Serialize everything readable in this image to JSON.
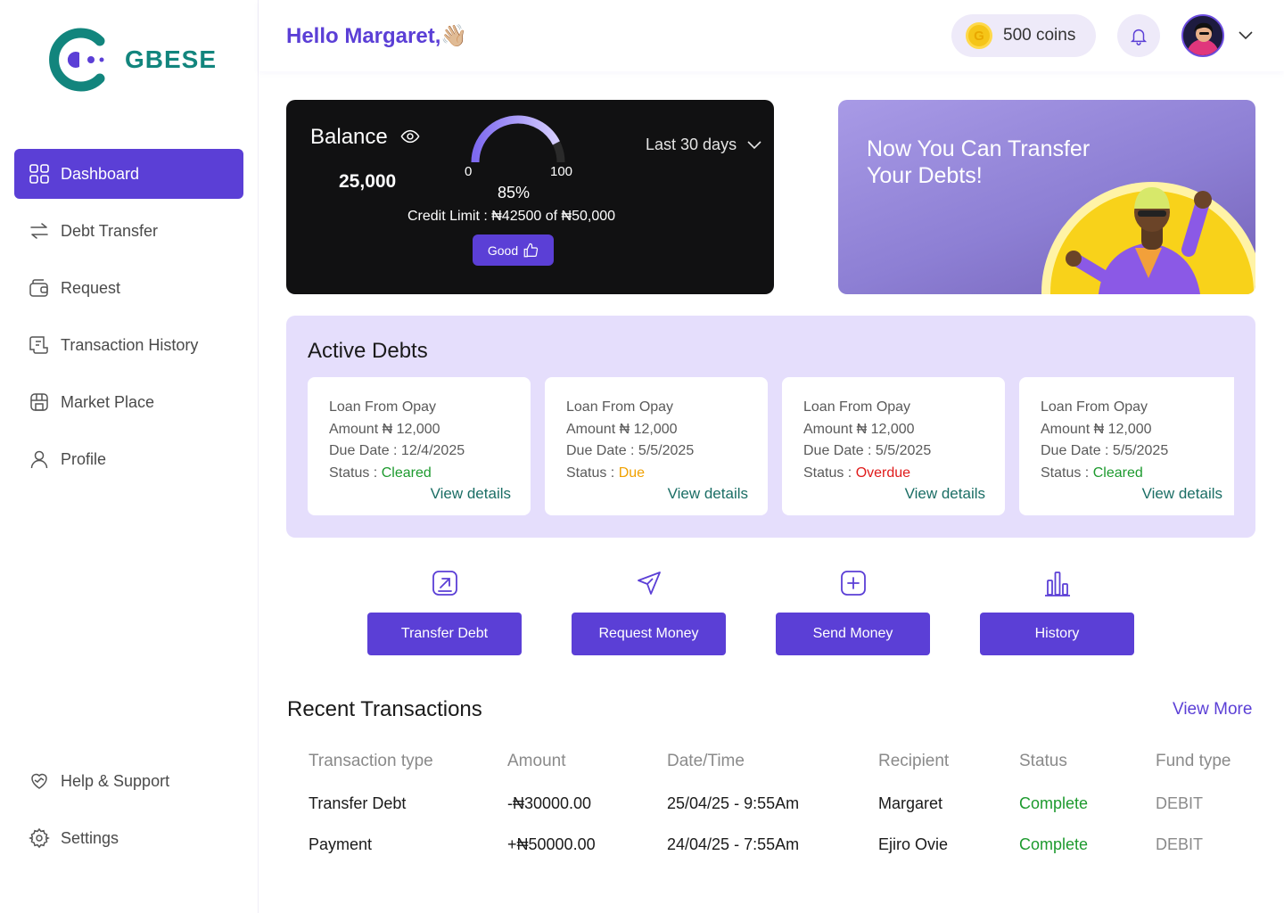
{
  "brand": {
    "name": "GBESE",
    "color": "#12857d"
  },
  "sidebar": {
    "items": [
      {
        "label": "Dashboard",
        "icon": "dashboard-grid-icon",
        "active": true
      },
      {
        "label": "Debt Transfer",
        "icon": "transfer-arrows-icon"
      },
      {
        "label": "Request",
        "icon": "wallet-icon"
      },
      {
        "label": "Transaction History",
        "icon": "receipt-icon"
      },
      {
        "label": "Market Place",
        "icon": "store-icon"
      },
      {
        "label": "Profile",
        "icon": "user-icon"
      }
    ],
    "bottom": [
      {
        "label": "Help & Support",
        "icon": "heart-support-icon"
      },
      {
        "label": "Settings",
        "icon": "gear-icon"
      }
    ]
  },
  "header": {
    "greeting": "Hello Margaret,",
    "wave": "👋🏼",
    "coins": "500 coins",
    "coin_glyph": "G"
  },
  "balance": {
    "title": "Balance",
    "amount": "25,000",
    "gauge_min": "0",
    "gauge_max": "100",
    "percent": "85%",
    "percent_value": 85,
    "credit_limit": "Credit Limit : ₦42500 of ₦50,000",
    "rating": "Good",
    "period": "Last 30 days"
  },
  "promo": {
    "text": "Now You Can Transfer Your Debts!"
  },
  "debts": {
    "title": "Active Debts",
    "view_label": "View details",
    "items": [
      {
        "source": "Loan From Opay",
        "amount": "Amount ₦ 12,000",
        "due": "Due Date : 12/4/2025",
        "status_label": "Status : ",
        "status": "Cleared"
      },
      {
        "source": "Loan From Opay",
        "amount": "Amount ₦ 12,000",
        "due": "Due Date : 5/5/2025",
        "status_label": "Status : ",
        "status": "Due"
      },
      {
        "source": "Loan From Opay",
        "amount": "Amount ₦ 12,000",
        "due": "Due Date : 5/5/2025",
        "status_label": "Status : ",
        "status": "Overdue"
      },
      {
        "source": "Loan From Opay",
        "amount": "Amount ₦ 12,000",
        "due": "Due Date : 5/5/2025",
        "status_label": "Status : ",
        "status": "Cleared"
      }
    ]
  },
  "actions": [
    {
      "label": "Transfer Debt",
      "icon": "transfer-out-icon"
    },
    {
      "label": "Request Money",
      "icon": "send-plane-icon"
    },
    {
      "label": "Send Money",
      "icon": "plus-square-icon"
    },
    {
      "label": "History",
      "icon": "bar-chart-icon"
    }
  ],
  "transactions": {
    "title": "Recent Transactions",
    "view_more": "View More",
    "columns": [
      "Transaction type",
      "Amount",
      "Date/Time",
      "Recipient",
      "Status",
      "Fund type"
    ],
    "rows": [
      [
        "Transfer Debt",
        "-₦30000.00",
        "25/04/25 - 9:55Am",
        "Margaret",
        "Complete",
        "DEBIT"
      ],
      [
        "Payment",
        "+₦50000.00",
        "24/04/25 - 7:55Am",
        "Ejiro Ovie",
        "Complete",
        "DEBIT"
      ]
    ]
  },
  "colors": {
    "accent": "#5b3fd6",
    "debts_bg": "#e5defc",
    "cleared": "#1d9a2e",
    "due": "#f0a100",
    "overdue": "#e01b1b"
  }
}
